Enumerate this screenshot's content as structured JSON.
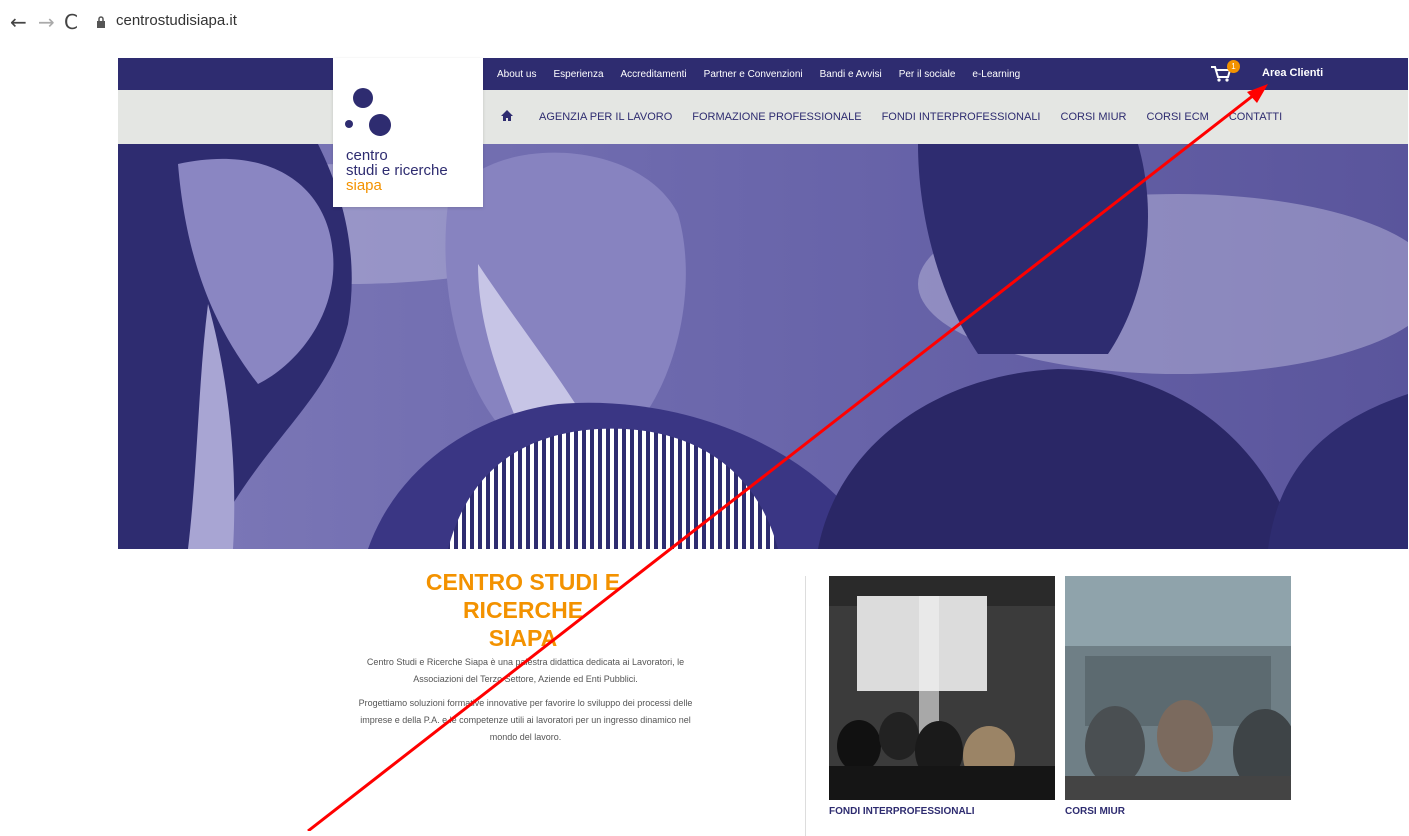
{
  "browser": {
    "url": "centrostudisiapa.it"
  },
  "topbar": {
    "links": [
      "About us",
      "Esperienza",
      "Accreditamenti",
      "Partner e Convenzioni",
      "Bandi e Avvisi",
      "Per il sociale",
      "e-Learning"
    ],
    "cart_count": "1",
    "area_clienti": "Area Clienti"
  },
  "logo": {
    "line1": "centro",
    "line2": "studi e ricerche",
    "line3": "siapa"
  },
  "mainnav": {
    "items": [
      "AGENZIA PER IL LAVORO",
      "FORMAZIONE PROFESSIONALE",
      "FONDI INTERPROFESSIONALI",
      "CORSI MIUR",
      "CORSI ECM",
      "CONTATTI"
    ]
  },
  "intro": {
    "title_line1": "CENTRO STUDI E RICERCHE",
    "title_line2": "SIAPA",
    "para1": "Centro Studi e Ricerche Siapa è una palestra didattica dedicata ai Lavoratori, le Associazioni del Terzo Settore, Aziende ed Enti Pubblici.",
    "para2": "Progettiamo soluzioni formative innovative per favorire lo sviluppo dei processi delle imprese e della P.A. e le competenze utili ai lavoratori per un ingresso dinamico nel mondo del lavoro."
  },
  "cards": [
    {
      "label": "FONDI INTERPROFESSIONALI"
    },
    {
      "label": "CORSI MIUR"
    }
  ],
  "colors": {
    "brand_navy": "#2e2c70",
    "accent_orange": "#f39200",
    "annotation_red": "#ff0000"
  }
}
